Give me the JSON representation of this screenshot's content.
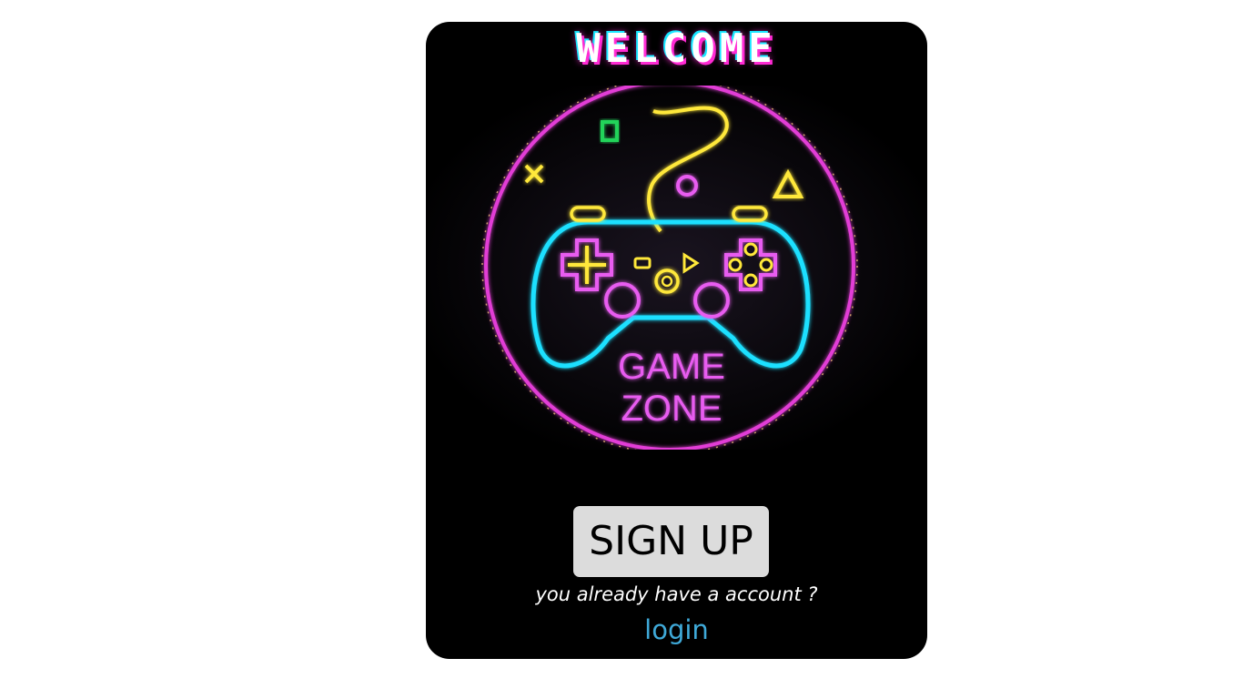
{
  "page": {
    "background": "#ffffff"
  },
  "card": {
    "background": "#000000",
    "title": "WELCOME",
    "logo": {
      "line1": "GAME",
      "line2": "ZONE",
      "icon": "gamepad-neon-icon",
      "colors": {
        "ring": "#e23cd6",
        "controller": "#1ee0ff",
        "accent": "#ffe83a",
        "text": "#e85cf0",
        "square": "#22d35a"
      }
    },
    "signup_label": "SIGN UP",
    "signup_bg": "#dcdcdc",
    "prompt_text": "you already have a account ?",
    "login_label": "login",
    "login_color": "#3fa9d8"
  }
}
